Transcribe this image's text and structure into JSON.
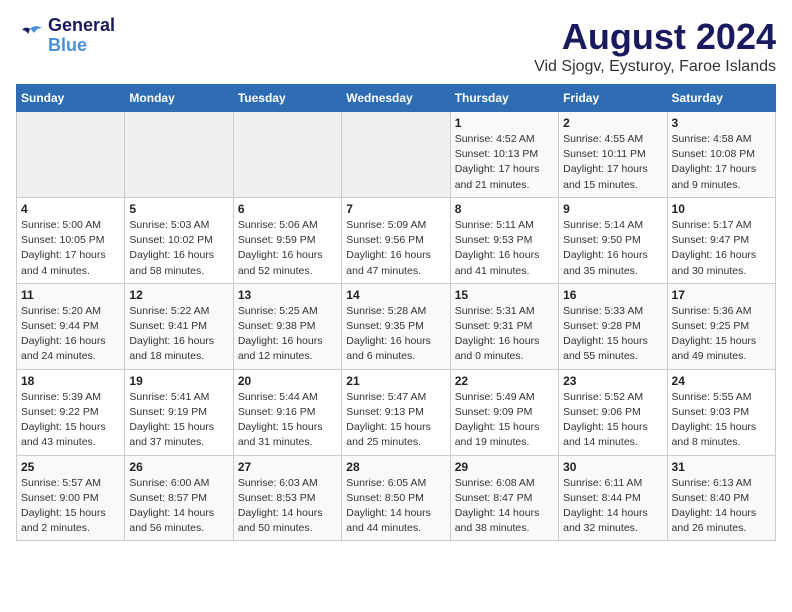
{
  "header": {
    "logo_line1": "General",
    "logo_line2": "Blue",
    "title": "August 2024",
    "subtitle": "Vid Sjogv, Eysturoy, Faroe Islands"
  },
  "calendar": {
    "days_of_week": [
      "Sunday",
      "Monday",
      "Tuesday",
      "Wednesday",
      "Thursday",
      "Friday",
      "Saturday"
    ],
    "weeks": [
      [
        {
          "day": "",
          "info": ""
        },
        {
          "day": "",
          "info": ""
        },
        {
          "day": "",
          "info": ""
        },
        {
          "day": "",
          "info": ""
        },
        {
          "day": "1",
          "info": "Sunrise: 4:52 AM\nSunset: 10:13 PM\nDaylight: 17 hours\nand 21 minutes."
        },
        {
          "day": "2",
          "info": "Sunrise: 4:55 AM\nSunset: 10:11 PM\nDaylight: 17 hours\nand 15 minutes."
        },
        {
          "day": "3",
          "info": "Sunrise: 4:58 AM\nSunset: 10:08 PM\nDaylight: 17 hours\nand 9 minutes."
        }
      ],
      [
        {
          "day": "4",
          "info": "Sunrise: 5:00 AM\nSunset: 10:05 PM\nDaylight: 17 hours\nand 4 minutes."
        },
        {
          "day": "5",
          "info": "Sunrise: 5:03 AM\nSunset: 10:02 PM\nDaylight: 16 hours\nand 58 minutes."
        },
        {
          "day": "6",
          "info": "Sunrise: 5:06 AM\nSunset: 9:59 PM\nDaylight: 16 hours\nand 52 minutes."
        },
        {
          "day": "7",
          "info": "Sunrise: 5:09 AM\nSunset: 9:56 PM\nDaylight: 16 hours\nand 47 minutes."
        },
        {
          "day": "8",
          "info": "Sunrise: 5:11 AM\nSunset: 9:53 PM\nDaylight: 16 hours\nand 41 minutes."
        },
        {
          "day": "9",
          "info": "Sunrise: 5:14 AM\nSunset: 9:50 PM\nDaylight: 16 hours\nand 35 minutes."
        },
        {
          "day": "10",
          "info": "Sunrise: 5:17 AM\nSunset: 9:47 PM\nDaylight: 16 hours\nand 30 minutes."
        }
      ],
      [
        {
          "day": "11",
          "info": "Sunrise: 5:20 AM\nSunset: 9:44 PM\nDaylight: 16 hours\nand 24 minutes."
        },
        {
          "day": "12",
          "info": "Sunrise: 5:22 AM\nSunset: 9:41 PM\nDaylight: 16 hours\nand 18 minutes."
        },
        {
          "day": "13",
          "info": "Sunrise: 5:25 AM\nSunset: 9:38 PM\nDaylight: 16 hours\nand 12 minutes."
        },
        {
          "day": "14",
          "info": "Sunrise: 5:28 AM\nSunset: 9:35 PM\nDaylight: 16 hours\nand 6 minutes."
        },
        {
          "day": "15",
          "info": "Sunrise: 5:31 AM\nSunset: 9:31 PM\nDaylight: 16 hours\nand 0 minutes."
        },
        {
          "day": "16",
          "info": "Sunrise: 5:33 AM\nSunset: 9:28 PM\nDaylight: 15 hours\nand 55 minutes."
        },
        {
          "day": "17",
          "info": "Sunrise: 5:36 AM\nSunset: 9:25 PM\nDaylight: 15 hours\nand 49 minutes."
        }
      ],
      [
        {
          "day": "18",
          "info": "Sunrise: 5:39 AM\nSunset: 9:22 PM\nDaylight: 15 hours\nand 43 minutes."
        },
        {
          "day": "19",
          "info": "Sunrise: 5:41 AM\nSunset: 9:19 PM\nDaylight: 15 hours\nand 37 minutes."
        },
        {
          "day": "20",
          "info": "Sunrise: 5:44 AM\nSunset: 9:16 PM\nDaylight: 15 hours\nand 31 minutes."
        },
        {
          "day": "21",
          "info": "Sunrise: 5:47 AM\nSunset: 9:13 PM\nDaylight: 15 hours\nand 25 minutes."
        },
        {
          "day": "22",
          "info": "Sunrise: 5:49 AM\nSunset: 9:09 PM\nDaylight: 15 hours\nand 19 minutes."
        },
        {
          "day": "23",
          "info": "Sunrise: 5:52 AM\nSunset: 9:06 PM\nDaylight: 15 hours\nand 14 minutes."
        },
        {
          "day": "24",
          "info": "Sunrise: 5:55 AM\nSunset: 9:03 PM\nDaylight: 15 hours\nand 8 minutes."
        }
      ],
      [
        {
          "day": "25",
          "info": "Sunrise: 5:57 AM\nSunset: 9:00 PM\nDaylight: 15 hours\nand 2 minutes."
        },
        {
          "day": "26",
          "info": "Sunrise: 6:00 AM\nSunset: 8:57 PM\nDaylight: 14 hours\nand 56 minutes."
        },
        {
          "day": "27",
          "info": "Sunrise: 6:03 AM\nSunset: 8:53 PM\nDaylight: 14 hours\nand 50 minutes."
        },
        {
          "day": "28",
          "info": "Sunrise: 6:05 AM\nSunset: 8:50 PM\nDaylight: 14 hours\nand 44 minutes."
        },
        {
          "day": "29",
          "info": "Sunrise: 6:08 AM\nSunset: 8:47 PM\nDaylight: 14 hours\nand 38 minutes."
        },
        {
          "day": "30",
          "info": "Sunrise: 6:11 AM\nSunset: 8:44 PM\nDaylight: 14 hours\nand 32 minutes."
        },
        {
          "day": "31",
          "info": "Sunrise: 6:13 AM\nSunset: 8:40 PM\nDaylight: 14 hours\nand 26 minutes."
        }
      ]
    ]
  }
}
